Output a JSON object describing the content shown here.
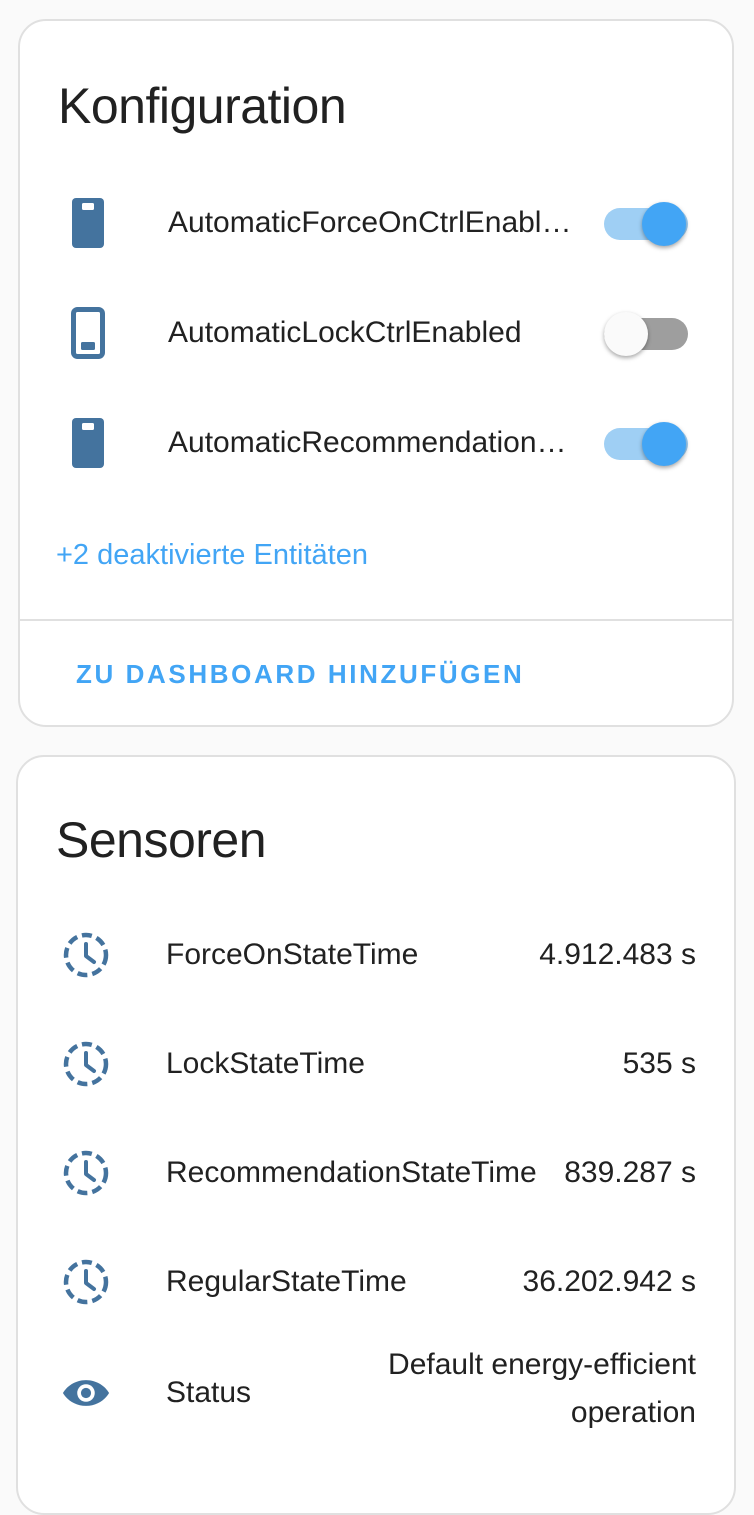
{
  "config_card": {
    "title": "Konfiguration",
    "entities": [
      {
        "name": "AutomaticForceOnCtrlEnabled",
        "icon": "tablet-on-icon",
        "state": "on"
      },
      {
        "name": "AutomaticLockCtrlEnabled",
        "icon": "tablet-off-icon",
        "state": "off"
      },
      {
        "name": "AutomaticRecommendationCtrlEnabled",
        "icon": "tablet-on-icon",
        "state": "on"
      }
    ],
    "disabled_entities_link": "+2 deaktivierte Entitäten",
    "add_to_dashboard_label": "ZU DASHBOARD HINZUFÜGEN"
  },
  "sensors_card": {
    "title": "Sensoren",
    "entities": [
      {
        "name": "ForceOnStateTime",
        "icon": "clock-dashed-icon",
        "value": "4.912.483 s"
      },
      {
        "name": "LockStateTime",
        "icon": "clock-dashed-icon",
        "value": "535 s"
      },
      {
        "name": "RecommendationStateTime",
        "icon": "clock-dashed-icon",
        "value": "839.287 s"
      },
      {
        "name": "RegularStateTime",
        "icon": "clock-dashed-icon",
        "value": "36.202.942 s"
      },
      {
        "name": "Status",
        "icon": "eye-icon",
        "value": "Default energy-efficient operation"
      }
    ]
  },
  "colors": {
    "accent": "#42a5f5",
    "accent_light": "#9fcff4",
    "icon": "#44739e",
    "toggle_off_track": "#9e9e9e"
  }
}
